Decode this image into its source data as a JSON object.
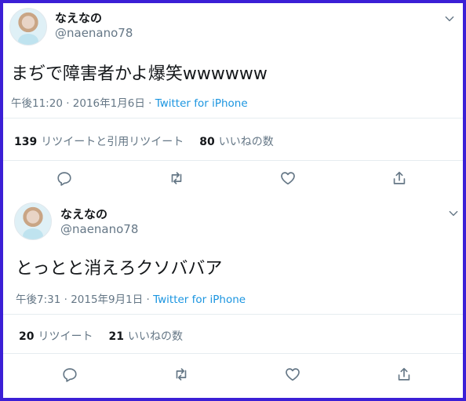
{
  "tweets": [
    {
      "name": "なえなの",
      "handle": "@naenano78",
      "text": "まぢで障害者かよ爆笑wwwwww",
      "time": "午後11:20 · 2016年1月6日 · ",
      "via": "Twitter for iPhone",
      "retweets_count": "139",
      "retweets_label": "リツイートと引用リツイート",
      "likes_count": "80",
      "likes_label": "いいねの数"
    },
    {
      "name": "なえなの",
      "handle": "@naenano78",
      "text": "とっとと消えろクソババア",
      "time": "午後7:31 · 2015年9月1日 · ",
      "via": "Twitter for iPhone",
      "retweets_count": "20",
      "retweets_label": "リツイート",
      "likes_count": "21",
      "likes_label": "いいねの数"
    }
  ],
  "icons": {
    "reply": "reply-icon",
    "retweet": "retweet-icon",
    "like": "heart-icon",
    "share": "share-icon",
    "more": "chevron-down-icon"
  },
  "colors": {
    "frame": "#3b1fd6",
    "link": "#1b95e0",
    "secondary_text": "#657786",
    "divider": "#e6ecf0"
  }
}
